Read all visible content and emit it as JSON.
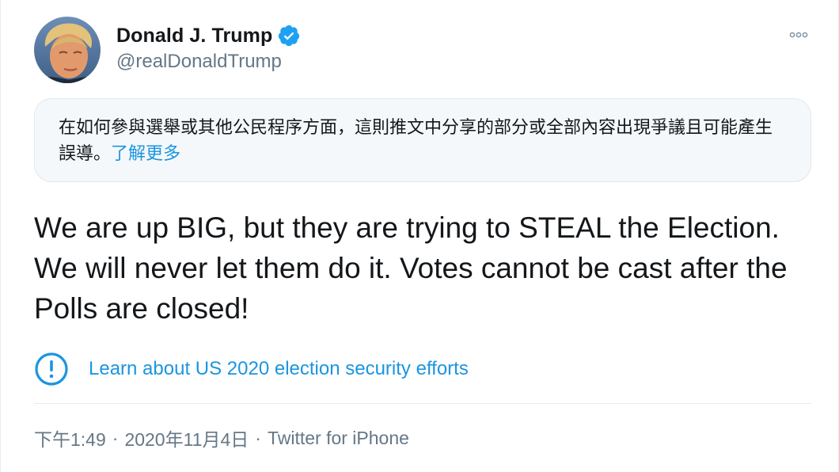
{
  "author": {
    "name": "Donald J. Trump",
    "handle": "@realDonaldTrump",
    "verified": true
  },
  "icons": {
    "verified": "verified-badge-icon",
    "more": "more-options-icon",
    "label": "exclamation-circle-icon",
    "avatar": "profile-photo"
  },
  "notice": {
    "text": "在如何參與選舉或其他公民程序方面，這則推文中分享的部分或全部內容出現爭議且可能產生誤導。",
    "link": "了解更多"
  },
  "tweet": {
    "text": "We are up BIG, but they are trying to STEAL the Election. We will never let them do it. Votes cannot be cast after the Polls are closed!"
  },
  "label": {
    "text": "Learn about US 2020 election security efforts"
  },
  "meta": {
    "time": "下午1:49",
    "date": "2020年11月4日",
    "source": "Twitter for iPhone",
    "separator": "·"
  },
  "colors": {
    "link": "#1b95e0",
    "text": "#14171a",
    "secondary": "#657786",
    "verified": "#1da1f2",
    "notice_bg": "#f5f8fa"
  }
}
